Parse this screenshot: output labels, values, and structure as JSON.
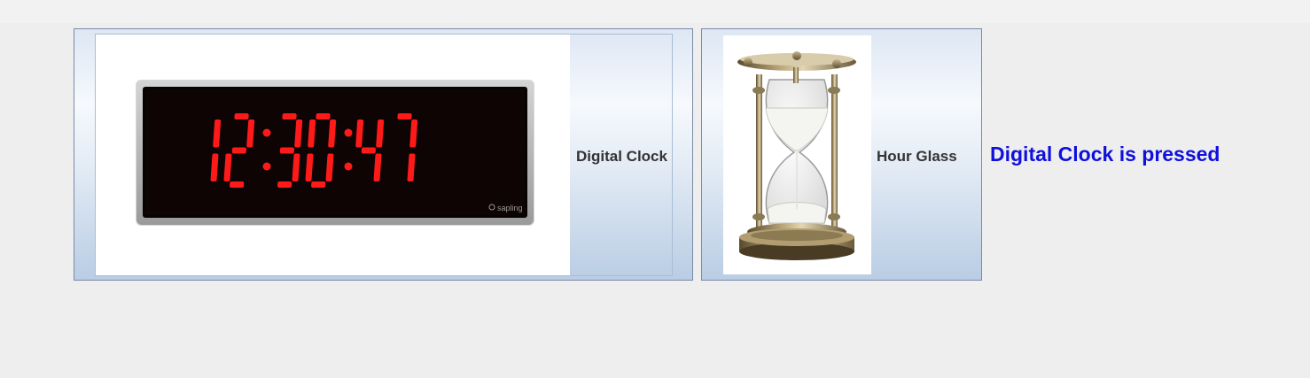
{
  "buttons": [
    {
      "label": "Digital Clock",
      "icon": "digital-clock-icon",
      "icon_display": {
        "time": "12:30:47",
        "brand": "sapling",
        "digit_color": "#ff1a1a"
      }
    },
    {
      "label": "Hour Glass",
      "icon": "hourglass-icon"
    }
  ],
  "status": {
    "text": "Digital Clock is pressed",
    "color": "#1010dd"
  }
}
